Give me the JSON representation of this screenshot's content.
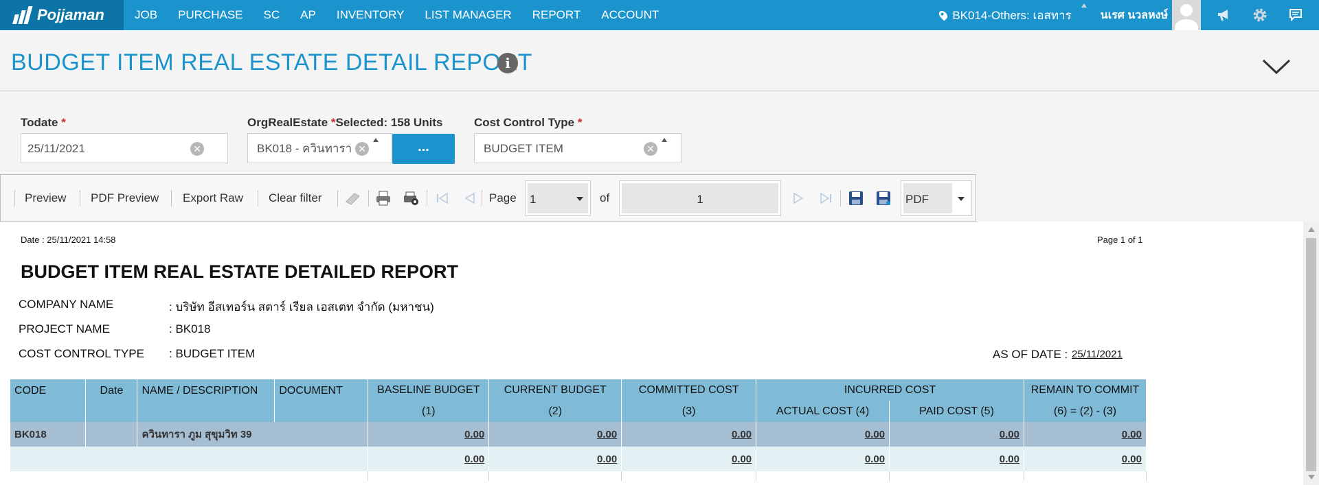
{
  "nav": {
    "brand": "Pojjaman",
    "menu": [
      "JOB",
      "PURCHASE",
      "SC",
      "AP",
      "INVENTORY",
      "LIST MANAGER",
      "REPORT",
      "ACCOUNT"
    ],
    "location": "BK014-Others: เอสทาร",
    "user": "นเรศ นวลหงษ์",
    "icons": [
      "megaphone-icon",
      "gear-icon",
      "chat-icon"
    ]
  },
  "page": {
    "title": "BUDGET ITEM REAL ESTATE DETAIL REPORT"
  },
  "filters": {
    "todate": {
      "label": "Todate",
      "value": "25/11/2021"
    },
    "org": {
      "label": "OrgRealEstate",
      "selected_note": "Selected: 158 Units",
      "value": "BK018 - ควินทารา ...",
      "button": "..."
    },
    "cost_type": {
      "label": "Cost Control Type",
      "value": "BUDGET ITEM"
    },
    "required_mark": "*"
  },
  "toolbar": {
    "preview": "Preview",
    "pdf_preview": "PDF Preview",
    "export_raw": "Export Raw",
    "clear_filter": "Clear filter",
    "page_label": "Page",
    "page_value": "1",
    "of_label": "of",
    "total_pages": "1",
    "format": "PDF"
  },
  "report": {
    "date": "Date : 25/11/2021 14:58",
    "page_info": "Page 1 of 1",
    "title": "BUDGET ITEM REAL ESTATE DETAILED REPORT",
    "company_label": "COMPANY NAME",
    "company_value": ": บริษัท อีสเทอร์น สตาร์ เรียล เอสเตท จำกัด (มหาชน)",
    "project_label": "PROJECT NAME",
    "project_value": ": BK018",
    "cost_label": "COST CONTROL TYPE",
    "cost_value": ": BUDGET ITEM",
    "asof_label": "AS OF DATE :",
    "asof_value": "25/11/2021",
    "headers": {
      "code": "CODE",
      "date": "Date",
      "name": "NAME / DESCRIPTION",
      "document": "DOCUMENT",
      "baseline": "BASELINE BUDGET",
      "baseline_sub": "(1)",
      "current": "CURRENT BUDGET",
      "current_sub": "(2)",
      "committed": "COMMITTED COST",
      "committed_sub": "(3)",
      "incurred": "INCURRED COST",
      "actual": "ACTUAL COST (4)",
      "paid": "PAID COST (5)",
      "remain": "REMAIN TO COMMIT",
      "remain_sub": "(6) = (2) - (3)"
    },
    "rows": [
      {
        "code": "BK018",
        "name": "ควินทารา ภูม สุขุมวิท 39",
        "baseline": "0.00",
        "current": "0.00",
        "committed": "0.00",
        "actual": "0.00",
        "paid": "0.00",
        "remain": "0.00"
      },
      {
        "code": "",
        "name": "",
        "baseline": "0.00",
        "current": "0.00",
        "committed": "0.00",
        "actual": "0.00",
        "paid": "0.00",
        "remain": "0.00"
      }
    ]
  },
  "colors": {
    "brand_blue": "#1b93cc",
    "header_cell": "#7fbbd7",
    "group_row": "#a6bed2",
    "sum_row": "#e3f1f4"
  }
}
